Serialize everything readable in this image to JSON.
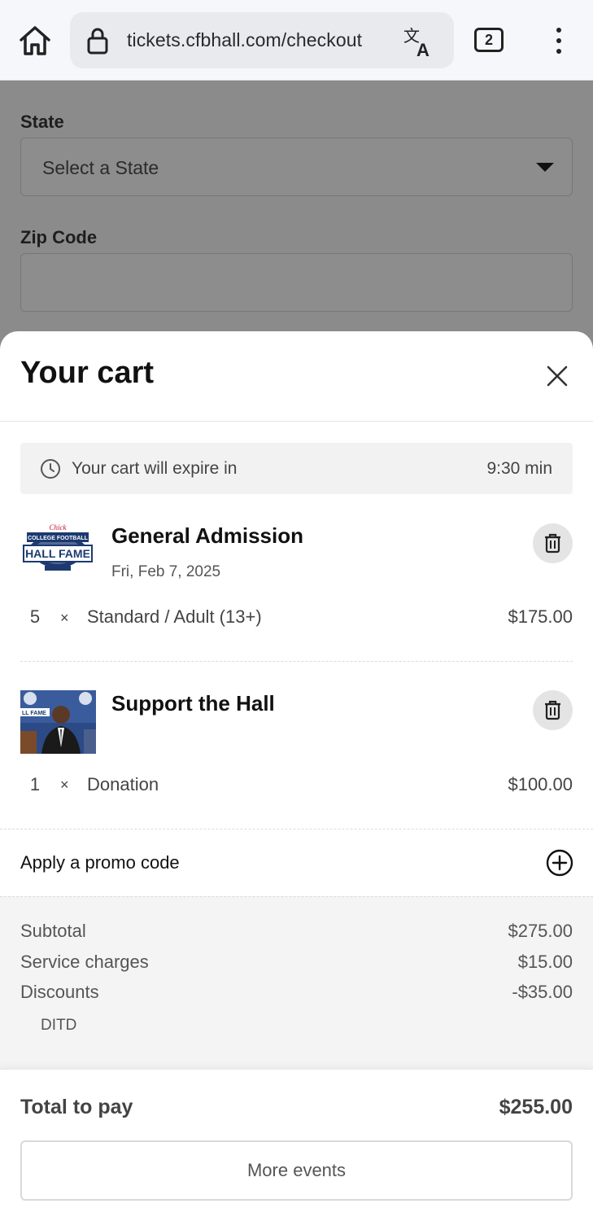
{
  "browser": {
    "url": "tickets.cfbhall.com/checkout",
    "tab_count": "2",
    "icons": [
      "home-icon",
      "lock-icon",
      "translate-icon",
      "tabs-icon",
      "more-vert-icon"
    ]
  },
  "background_form": {
    "state_label": "State",
    "state_placeholder": "Select a State",
    "zip_label": "Zip Code",
    "zip_value": ""
  },
  "cart": {
    "title": "Your cart",
    "timer": {
      "label": "Your cart will expire in",
      "value": "9:30 min"
    },
    "items": [
      {
        "title": "General Admission",
        "date": "Fri, Feb 7, 2025",
        "image": "hall-of-fame-logo",
        "lines": [
          {
            "qty": "5",
            "times": "×",
            "description": "Standard / Adult (13+)",
            "price": "$175.00"
          }
        ]
      },
      {
        "title": "Support the Hall",
        "date": "",
        "image": "hall-of-fame-photo",
        "lines": [
          {
            "qty": "1",
            "times": "×",
            "description": "Donation",
            "price": "$100.00"
          }
        ]
      }
    ],
    "promo_label": "Apply a promo code",
    "summary": {
      "subtotal_label": "Subtotal",
      "subtotal_value": "$275.00",
      "service_label": "Service charges",
      "service_value": "$15.00",
      "discounts_label": "Discounts",
      "discounts_value": "-$35.00",
      "discount_code": "DITD"
    },
    "total_label": "Total to pay",
    "total_value": "$255.00",
    "more_events_label": "More events"
  },
  "colors": {
    "overlay": "#8a8a8a",
    "chrome_bg": "#f6f7fb",
    "summary_bg": "#f4f4f4",
    "trash_bg": "#e4e4e4",
    "logo_navy": "#1c3a70"
  }
}
